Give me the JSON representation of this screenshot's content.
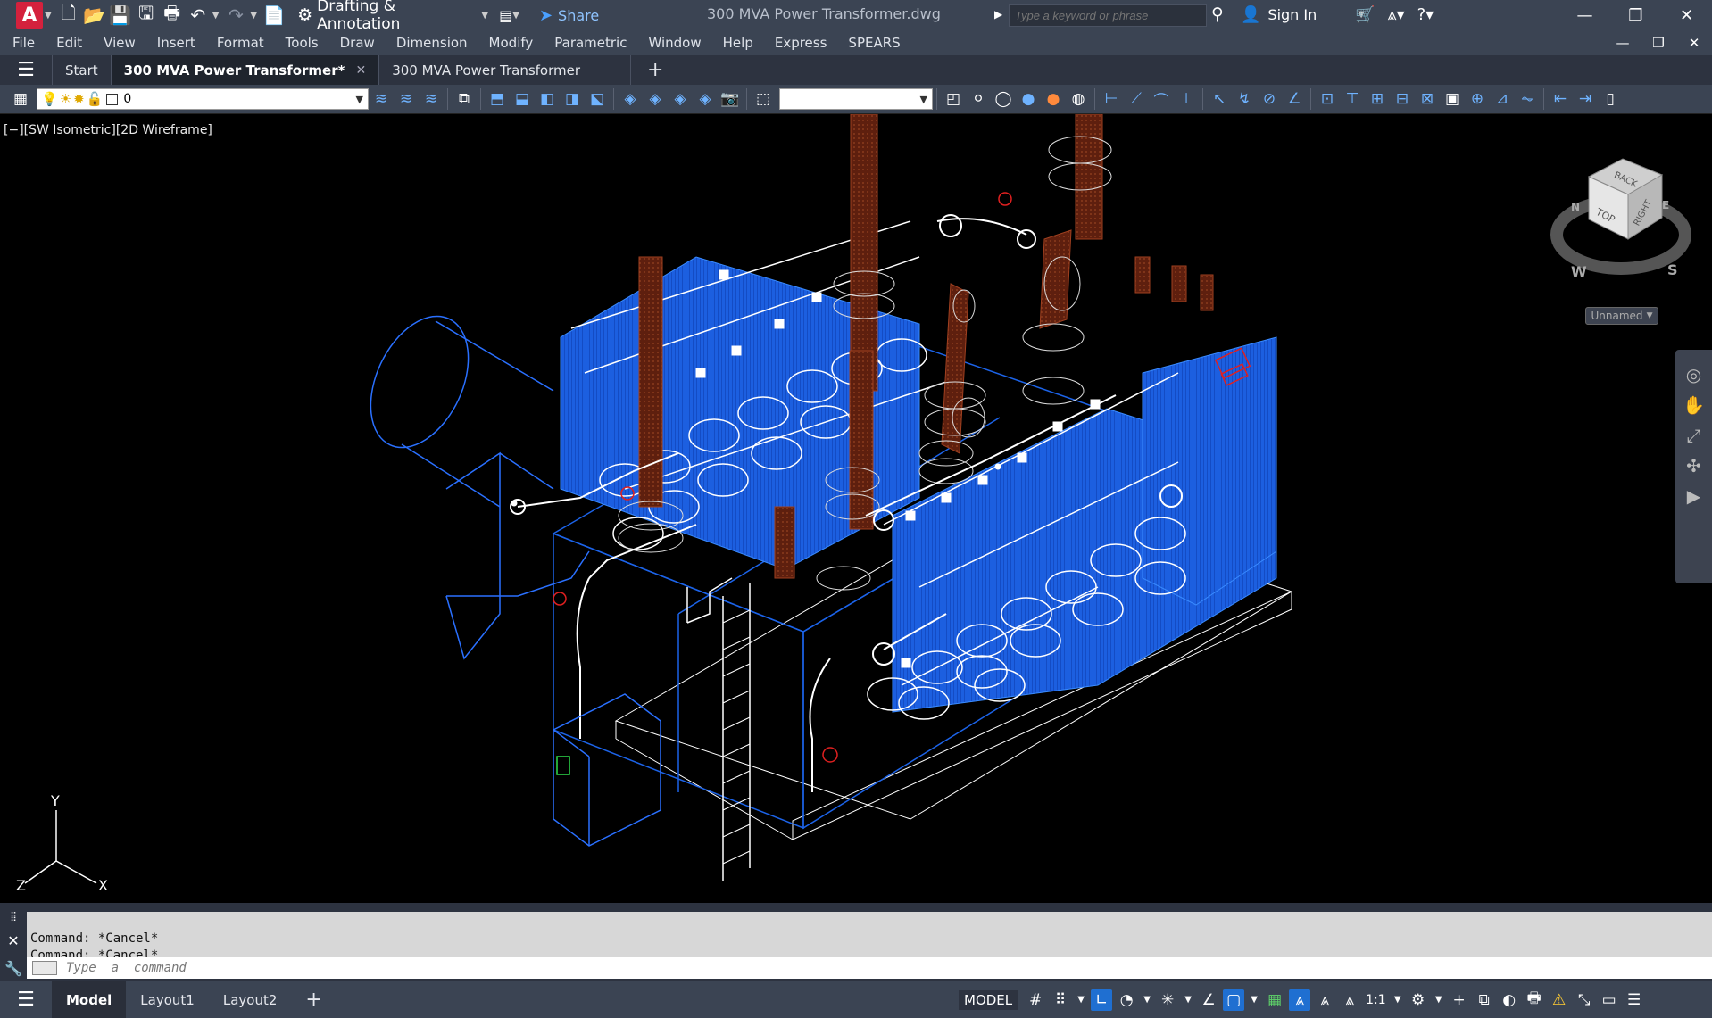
{
  "app": {
    "logo_letter": "A",
    "workspace": "Drafting & Annotation",
    "share_label": "Share",
    "document_title": "300 MVA Power Transformer.dwg",
    "search_placeholder": "Type a keyword or phrase",
    "signin_label": "Sign In"
  },
  "menu": [
    "File",
    "Edit",
    "View",
    "Insert",
    "Format",
    "Tools",
    "Draw",
    "Dimension",
    "Modify",
    "Parametric",
    "Window",
    "Help",
    "Express",
    "SPEARS"
  ],
  "tabs": {
    "start": "Start",
    "active": "300 MVA Power Transformer*",
    "second": "300 MVA Power Transformer",
    "close_glyph": "✕",
    "plus_glyph": "+"
  },
  "toolbar": {
    "layer_value": "0",
    "style_value": ""
  },
  "viewport": {
    "label": "[−][SW Isometric][2D Wireframe]",
    "viewcube": {
      "top": "TOP",
      "front": "RIGHT",
      "back": "BACK",
      "compass_w": "W",
      "compass_s": "S",
      "compass_n": "N",
      "compass_e": "E",
      "named_view": "Unnamed"
    },
    "ucs": {
      "x": "X",
      "y": "Y",
      "z": "Z"
    }
  },
  "command": {
    "history": [
      "Command: *Cancel*",
      "Command: *Cancel*"
    ],
    "placeholder": "Type  a  command"
  },
  "status": {
    "layouts": [
      "Model",
      "Layout1",
      "Layout2"
    ],
    "model_label": "MODEL",
    "scale_label": "1:1"
  },
  "colors": {
    "titlebar": "#3b4453",
    "accent_blue": "#1e6ff0",
    "tank_blue": "#1c63e8",
    "bushing_brown": "#6b2310",
    "wire_white": "#ffffff"
  }
}
